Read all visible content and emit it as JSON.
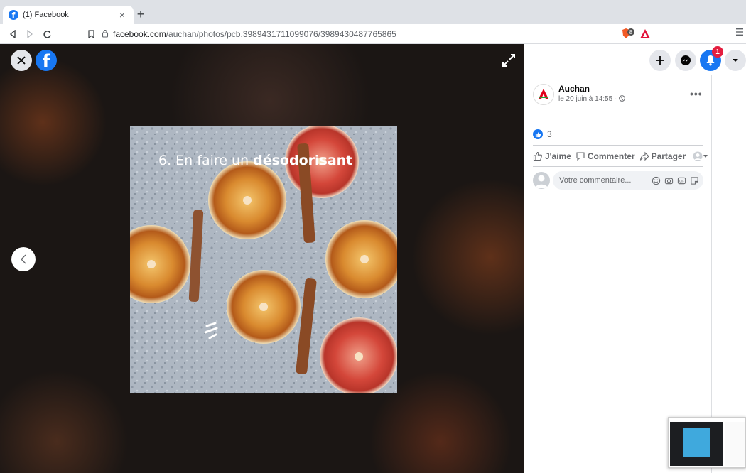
{
  "browser": {
    "tab_title": "(1) Facebook",
    "tab_close": "×",
    "new_tab": "+",
    "url_host": "facebook.com",
    "url_path": "/auchan/photos/pcb.3989431711099076/3989430487765865",
    "brave_badge": "8"
  },
  "viewer": {
    "photo_caption_plain": "6. En faire un ",
    "photo_caption_bold": "désodorisant"
  },
  "header": {
    "notification_count": "1"
  },
  "post": {
    "page_name": "Auchan",
    "timestamp": "le 20 juin à 14:55 · ",
    "more": "•••",
    "reaction_count": "3",
    "like_label": "J'aime",
    "comment_label": "Commenter",
    "share_label": "Partager",
    "comment_placeholder": "Votre commentaire..."
  },
  "colors": {
    "facebook_blue": "#1877f2",
    "notification_red": "#e41e3f",
    "auchan_red": "#e2001a"
  }
}
